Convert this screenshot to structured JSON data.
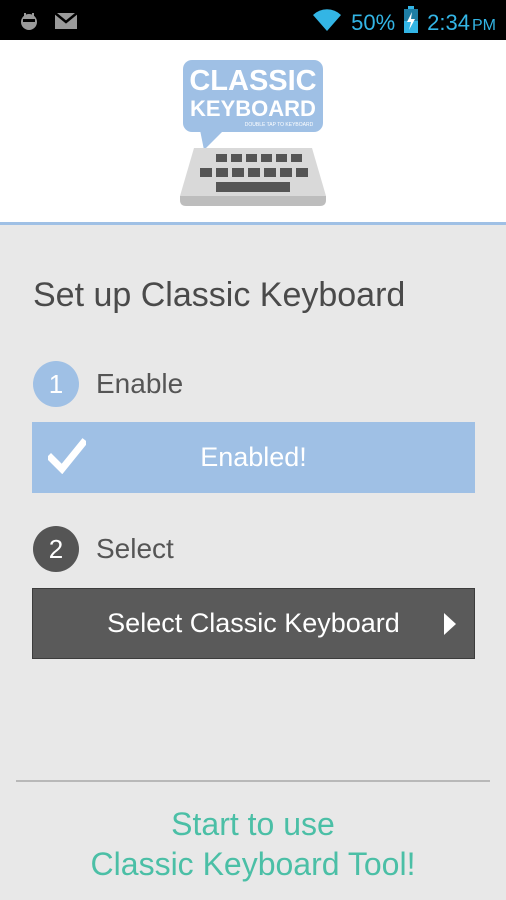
{
  "status_bar": {
    "battery_percent": "50%",
    "time": "2:34",
    "ampm": "PM",
    "icons": [
      "android-debug-icon",
      "gmail-icon",
      "wifi-icon",
      "battery-charging-icon"
    ]
  },
  "header": {
    "logo_title_line1": "CLASSIC",
    "logo_title_line2": "KEYBOARD",
    "logo_tagline": "DOUBLE TAP TO KEYBOARD"
  },
  "main": {
    "title": "Set up Classic Keyboard",
    "steps": [
      {
        "number": "1",
        "label": "Enable",
        "button_label": "Enabled!",
        "done": true
      },
      {
        "number": "2",
        "label": "Select",
        "button_label": "Select Classic Keyboard",
        "done": false
      }
    ]
  },
  "footer": {
    "line1": "Start to use",
    "line2": "Classic Keyboard Tool!"
  },
  "colors": {
    "accent_blue": "#9fc0e5",
    "status_blue": "#33b5e5",
    "dark_button": "#5a5a5a",
    "footer_teal": "#4bbfa6"
  }
}
